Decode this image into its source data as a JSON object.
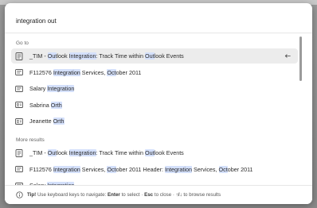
{
  "search": {
    "value": "integration out"
  },
  "sections": {
    "goto_label": "Go to",
    "more_label": "More results"
  },
  "goto_items": [
    {
      "icon": "document-icon",
      "parts": [
        [
          "_TIM - ",
          false
        ],
        [
          "Out",
          true
        ],
        [
          "look ",
          false
        ],
        [
          "Integration",
          true
        ],
        [
          ": Track Time within ",
          false
        ],
        [
          "Out",
          true
        ],
        [
          "look Events",
          false
        ]
      ],
      "selected": true
    },
    {
      "icon": "contact-card-icon",
      "parts": [
        [
          "F112576 ",
          false
        ],
        [
          "Integration",
          true
        ],
        [
          " Services, ",
          false
        ],
        [
          "Oct",
          true
        ],
        [
          "ober 2011",
          false
        ]
      ],
      "selected": false
    },
    {
      "icon": "contact-card-icon",
      "parts": [
        [
          "Salary ",
          false
        ],
        [
          "Integration",
          true
        ]
      ],
      "selected": false
    },
    {
      "icon": "person-card-icon",
      "parts": [
        [
          "Sabrina ",
          false
        ],
        [
          "Orth",
          true
        ]
      ],
      "selected": false
    },
    {
      "icon": "person-card-icon",
      "parts": [
        [
          "Jeanette ",
          false
        ],
        [
          "Orth",
          true
        ]
      ],
      "selected": false
    }
  ],
  "more_items": [
    {
      "icon": "document-icon",
      "parts": [
        [
          "_TIM - ",
          false
        ],
        [
          "Out",
          true
        ],
        [
          "look ",
          false
        ],
        [
          "Integration",
          true
        ],
        [
          ": Track Time within ",
          false
        ],
        [
          "Out",
          true
        ],
        [
          "look Events",
          false
        ]
      ]
    },
    {
      "icon": "contact-card-icon",
      "parts": [
        [
          "F112576 ",
          false
        ],
        [
          "Integration",
          true
        ],
        [
          " Services, ",
          false
        ],
        [
          "Oct",
          true
        ],
        [
          "ober 2011",
          false
        ],
        [
          "   Header: ",
          false
        ],
        [
          "Integration",
          true
        ],
        [
          " Services, ",
          false
        ],
        [
          "Oct",
          true
        ],
        [
          "ober 2011",
          false
        ]
      ]
    },
    {
      "icon": "contact-card-icon",
      "parts": [
        [
          "Salary ",
          false
        ],
        [
          "Integration",
          true
        ]
      ]
    }
  ],
  "footer": {
    "icon": "info-circle-icon",
    "tip_label": "Tip!",
    "tip_text_1": " Use keyboard keys to navigate: ",
    "enter": "Enter",
    "tip_text_2": " to select · ",
    "esc": "Esc",
    "tip_text_3": " to close · ",
    "arrows": "↑/↓",
    "tip_text_4": " to browse results"
  },
  "colors": {
    "highlight": "#d4e0fb",
    "selected_row": "#ececec"
  }
}
